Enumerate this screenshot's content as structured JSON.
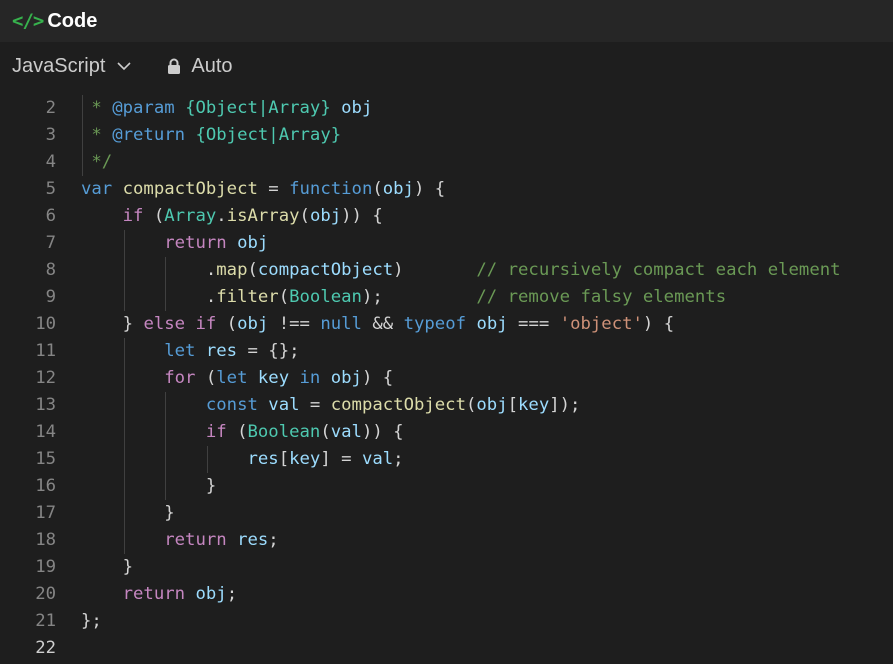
{
  "window": {
    "title": "Code",
    "icon": "code-brackets-icon"
  },
  "toolbar": {
    "language": "JavaScript",
    "mode": "Auto"
  },
  "colors": {
    "background": "#1e1e1e",
    "titlebar": "#262626",
    "comment": "#6a9955",
    "keyword": "#569cd6",
    "control": "#c586c0",
    "function": "#dcdcaa",
    "variable": "#9cdcfe",
    "type": "#4ec9b0",
    "string": "#ce9178",
    "accent": "#37b24d"
  },
  "editor": {
    "active_line": "22",
    "lines": [
      {
        "number": "2",
        "tokens": [
          {
            "t": " * ",
            "c": "comment"
          },
          {
            "t": "@param",
            "c": "tag"
          },
          {
            "t": " ",
            "c": "comment"
          },
          {
            "t": "{Object|Array}",
            "c": "type"
          },
          {
            "t": " ",
            "c": "comment"
          },
          {
            "t": "obj",
            "c": "var"
          }
        ]
      },
      {
        "number": "3",
        "tokens": [
          {
            "t": " * ",
            "c": "comment"
          },
          {
            "t": "@return",
            "c": "tag"
          },
          {
            "t": " ",
            "c": "comment"
          },
          {
            "t": "{Object|Array}",
            "c": "type"
          }
        ]
      },
      {
        "number": "4",
        "tokens": [
          {
            "t": " */",
            "c": "comment"
          }
        ]
      },
      {
        "number": "5",
        "tokens": [
          {
            "t": "var",
            "c": "kw"
          },
          {
            "t": " ",
            "c": "punc"
          },
          {
            "t": "compactObject",
            "c": "fn"
          },
          {
            "t": " = ",
            "c": "punc"
          },
          {
            "t": "function",
            "c": "kw"
          },
          {
            "t": "(",
            "c": "punc"
          },
          {
            "t": "obj",
            "c": "var"
          },
          {
            "t": ") {",
            "c": "punc"
          }
        ]
      },
      {
        "number": "6",
        "tokens": [
          {
            "t": "    ",
            "c": "punc"
          },
          {
            "t": "if",
            "c": "ctrl"
          },
          {
            "t": " (",
            "c": "punc"
          },
          {
            "t": "Array",
            "c": "type"
          },
          {
            "t": ".",
            "c": "punc"
          },
          {
            "t": "isArray",
            "c": "fn"
          },
          {
            "t": "(",
            "c": "punc"
          },
          {
            "t": "obj",
            "c": "var"
          },
          {
            "t": ")) {",
            "c": "punc"
          }
        ]
      },
      {
        "number": "7",
        "tokens": [
          {
            "t": "        ",
            "c": "punc"
          },
          {
            "t": "return",
            "c": "ctrl"
          },
          {
            "t": " ",
            "c": "punc"
          },
          {
            "t": "obj",
            "c": "var"
          }
        ]
      },
      {
        "number": "8",
        "tokens": [
          {
            "t": "            .",
            "c": "punc"
          },
          {
            "t": "map",
            "c": "fn"
          },
          {
            "t": "(",
            "c": "punc"
          },
          {
            "t": "compactObject",
            "c": "var"
          },
          {
            "t": ")       ",
            "c": "punc"
          },
          {
            "t": "// recursively compact each element",
            "c": "comment"
          }
        ]
      },
      {
        "number": "9",
        "tokens": [
          {
            "t": "            .",
            "c": "punc"
          },
          {
            "t": "filter",
            "c": "fn"
          },
          {
            "t": "(",
            "c": "punc"
          },
          {
            "t": "Boolean",
            "c": "type"
          },
          {
            "t": ");         ",
            "c": "punc"
          },
          {
            "t": "// remove falsy elements",
            "c": "comment"
          }
        ]
      },
      {
        "number": "10",
        "tokens": [
          {
            "t": "    } ",
            "c": "punc"
          },
          {
            "t": "else",
            "c": "ctrl"
          },
          {
            "t": " ",
            "c": "punc"
          },
          {
            "t": "if",
            "c": "ctrl"
          },
          {
            "t": " (",
            "c": "punc"
          },
          {
            "t": "obj",
            "c": "var"
          },
          {
            "t": " !== ",
            "c": "punc"
          },
          {
            "t": "null",
            "c": "kw"
          },
          {
            "t": " && ",
            "c": "punc"
          },
          {
            "t": "typeof",
            "c": "kw"
          },
          {
            "t": " ",
            "c": "punc"
          },
          {
            "t": "obj",
            "c": "var"
          },
          {
            "t": " === ",
            "c": "punc"
          },
          {
            "t": "'object'",
            "c": "str"
          },
          {
            "t": ") {",
            "c": "punc"
          }
        ]
      },
      {
        "number": "11",
        "tokens": [
          {
            "t": "        ",
            "c": "punc"
          },
          {
            "t": "let",
            "c": "kw"
          },
          {
            "t": " ",
            "c": "punc"
          },
          {
            "t": "res",
            "c": "var"
          },
          {
            "t": " = {};",
            "c": "punc"
          }
        ]
      },
      {
        "number": "12",
        "tokens": [
          {
            "t": "        ",
            "c": "punc"
          },
          {
            "t": "for",
            "c": "ctrl"
          },
          {
            "t": " (",
            "c": "punc"
          },
          {
            "t": "let",
            "c": "kw"
          },
          {
            "t": " ",
            "c": "punc"
          },
          {
            "t": "key",
            "c": "var"
          },
          {
            "t": " ",
            "c": "punc"
          },
          {
            "t": "in",
            "c": "kw"
          },
          {
            "t": " ",
            "c": "punc"
          },
          {
            "t": "obj",
            "c": "var"
          },
          {
            "t": ") {",
            "c": "punc"
          }
        ]
      },
      {
        "number": "13",
        "tokens": [
          {
            "t": "            ",
            "c": "punc"
          },
          {
            "t": "const",
            "c": "kw"
          },
          {
            "t": " ",
            "c": "punc"
          },
          {
            "t": "val",
            "c": "var"
          },
          {
            "t": " = ",
            "c": "punc"
          },
          {
            "t": "compactObject",
            "c": "fn"
          },
          {
            "t": "(",
            "c": "punc"
          },
          {
            "t": "obj",
            "c": "var"
          },
          {
            "t": "[",
            "c": "punc"
          },
          {
            "t": "key",
            "c": "var"
          },
          {
            "t": "]);",
            "c": "punc"
          }
        ]
      },
      {
        "number": "14",
        "tokens": [
          {
            "t": "            ",
            "c": "punc"
          },
          {
            "t": "if",
            "c": "ctrl"
          },
          {
            "t": " (",
            "c": "punc"
          },
          {
            "t": "Boolean",
            "c": "type"
          },
          {
            "t": "(",
            "c": "punc"
          },
          {
            "t": "val",
            "c": "var"
          },
          {
            "t": ")) {",
            "c": "punc"
          }
        ]
      },
      {
        "number": "15",
        "tokens": [
          {
            "t": "                ",
            "c": "punc"
          },
          {
            "t": "res",
            "c": "var"
          },
          {
            "t": "[",
            "c": "punc"
          },
          {
            "t": "key",
            "c": "var"
          },
          {
            "t": "] = ",
            "c": "punc"
          },
          {
            "t": "val",
            "c": "var"
          },
          {
            "t": ";",
            "c": "punc"
          }
        ]
      },
      {
        "number": "16",
        "tokens": [
          {
            "t": "            }",
            "c": "punc"
          }
        ]
      },
      {
        "number": "17",
        "tokens": [
          {
            "t": "        }",
            "c": "punc"
          }
        ]
      },
      {
        "number": "18",
        "tokens": [
          {
            "t": "        ",
            "c": "punc"
          },
          {
            "t": "return",
            "c": "ctrl"
          },
          {
            "t": " ",
            "c": "punc"
          },
          {
            "t": "res",
            "c": "var"
          },
          {
            "t": ";",
            "c": "punc"
          }
        ]
      },
      {
        "number": "19",
        "tokens": [
          {
            "t": "    }",
            "c": "punc"
          }
        ]
      },
      {
        "number": "20",
        "tokens": [
          {
            "t": "    ",
            "c": "punc"
          },
          {
            "t": "return",
            "c": "ctrl"
          },
          {
            "t": " ",
            "c": "punc"
          },
          {
            "t": "obj",
            "c": "var"
          },
          {
            "t": ";",
            "c": "punc"
          }
        ]
      },
      {
        "number": "21",
        "tokens": [
          {
            "t": "};",
            "c": "punc"
          }
        ]
      },
      {
        "number": "22",
        "tokens": []
      }
    ]
  }
}
